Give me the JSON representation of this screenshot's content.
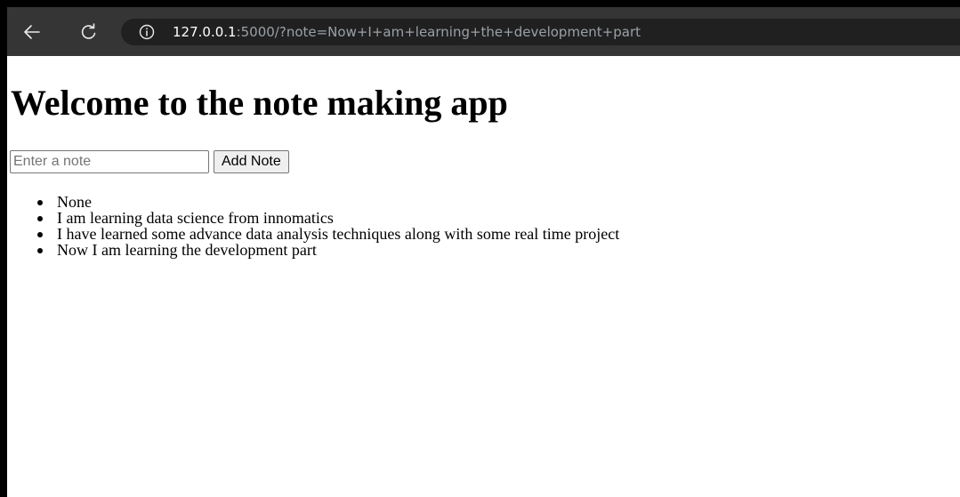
{
  "browser": {
    "url_host": "127.0.0.1",
    "url_rest": ":5000/?note=Now+I+am+learning+the+development+part"
  },
  "page": {
    "heading": "Welcome to the note making app",
    "form": {
      "input_placeholder": "Enter a note",
      "input_value": "",
      "submit_label": "Add Note"
    },
    "notes": [
      "None",
      "I am learning data science from innomatics",
      "I have learned some advance data analysis techniques along with some real time project",
      "Now I am learning the development part"
    ]
  },
  "colors": {
    "toolbar": "#353535",
    "address_bar": "#202020",
    "url_host": "#ffffff",
    "url_rest": "#9aa0a6",
    "page_background": "#ffffff"
  },
  "icons": {
    "back": "back-arrow-icon",
    "reload": "reload-icon",
    "info": "info-icon"
  }
}
